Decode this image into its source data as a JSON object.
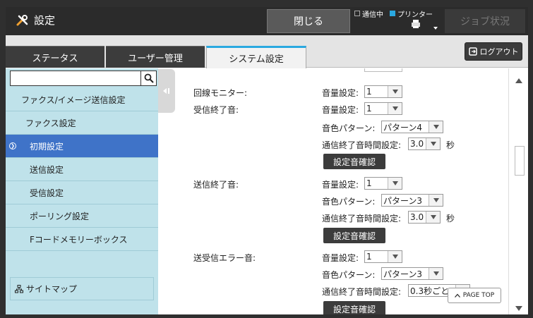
{
  "header": {
    "title": "設定",
    "close_label": "閉じる",
    "status_comm": "通信中",
    "status_printer": "プリンター",
    "job_label": "ジョブ状況"
  },
  "tabs": [
    {
      "label": "ステータス"
    },
    {
      "label": "ユーザー管理"
    },
    {
      "label": "システム設定"
    }
  ],
  "logout_label": "ログアウト",
  "sidebar": {
    "items": [
      {
        "label": "ファクス/イメージ送信設定"
      },
      {
        "label": "ファクス設定"
      },
      {
        "label": "初期設定"
      },
      {
        "label": "送信設定"
      },
      {
        "label": "受信設定"
      },
      {
        "label": "ポーリング設定"
      },
      {
        "label": "Fコードメモリーボックス"
      }
    ],
    "sitemap_label": "サイトマップ"
  },
  "content": {
    "line_monitor": {
      "label": "回線モニター:",
      "volume_label": "音量設定:",
      "volume": "1"
    },
    "recv_end": {
      "label": "受信終了音:",
      "volume_label": "音量設定:",
      "volume": "1",
      "pattern_label": "音色パターン:",
      "pattern": "パターン4",
      "time_label": "通信終了音時間設定:",
      "time": "3.0",
      "unit": "秒",
      "confirm": "設定音確認"
    },
    "send_end": {
      "label": "送信終了音:",
      "volume_label": "音量設定:",
      "volume": "1",
      "pattern_label": "音色パターン:",
      "pattern": "パターン3",
      "time_label": "通信終了音時間設定:",
      "time": "3.0",
      "unit": "秒",
      "confirm": "設定音確認"
    },
    "error": {
      "label": "送受信エラー音:",
      "volume_label": "音量設定:",
      "volume": "1",
      "pattern_label": "音色パターン:",
      "pattern": "パターン3",
      "time_label": "通信終了音時間設定:",
      "time": "0.3秒ごと",
      "confirm": "設定音確認"
    }
  },
  "pagetop_label": "PAGE TOP",
  "colors": {
    "accent": "#2aa8e0",
    "sidebar_bg": "#bfe2ea",
    "sidebar_selected": "#3f73c8",
    "dark_button": "#3c3c3c"
  }
}
